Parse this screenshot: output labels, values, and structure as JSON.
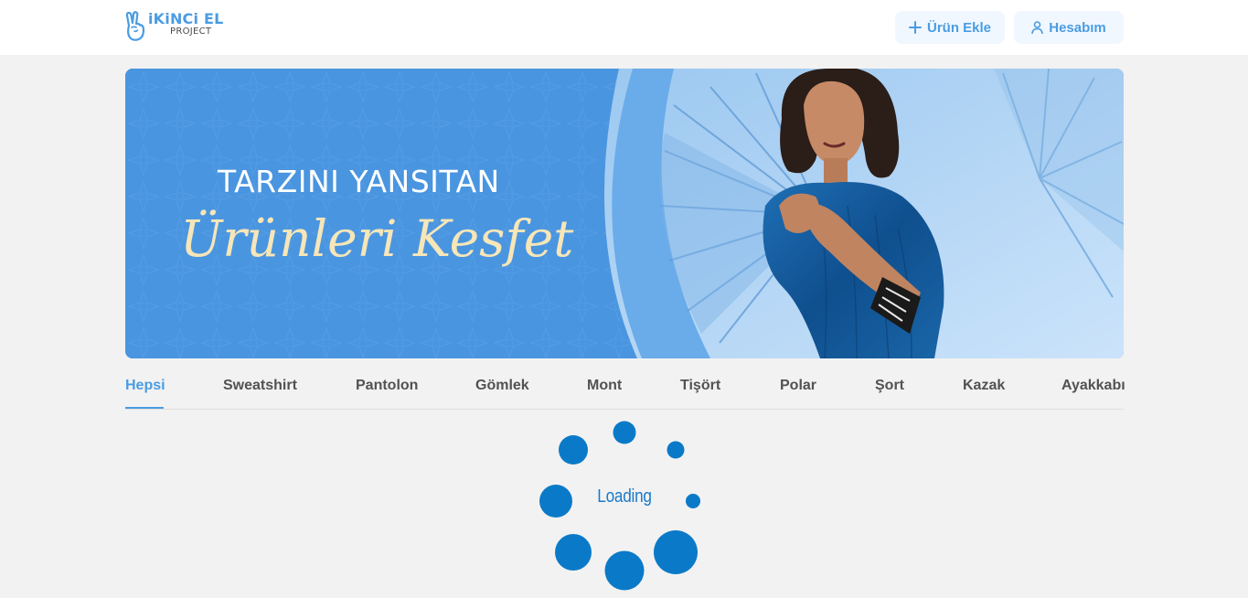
{
  "header": {
    "logo_main": "iKiNCi EL",
    "logo_sub": "PROJECT",
    "add_product_label": "Ürün Ekle",
    "account_label": "Hesabım"
  },
  "banner": {
    "line1": "TARZINI YANSITAN",
    "line2": "Ürünleri Kesfet"
  },
  "categories": {
    "items": [
      "Hepsi",
      "Sweatshirt",
      "Pantolon",
      "Gömlek",
      "Mont",
      "Tişört",
      "Polar",
      "Şort",
      "Kazak",
      "Ayakkabı"
    ],
    "active": "Hepsi"
  },
  "loader": {
    "text": "Loading"
  },
  "colors": {
    "accent": "#4b9ce2",
    "loader": "#0a7ac8"
  }
}
